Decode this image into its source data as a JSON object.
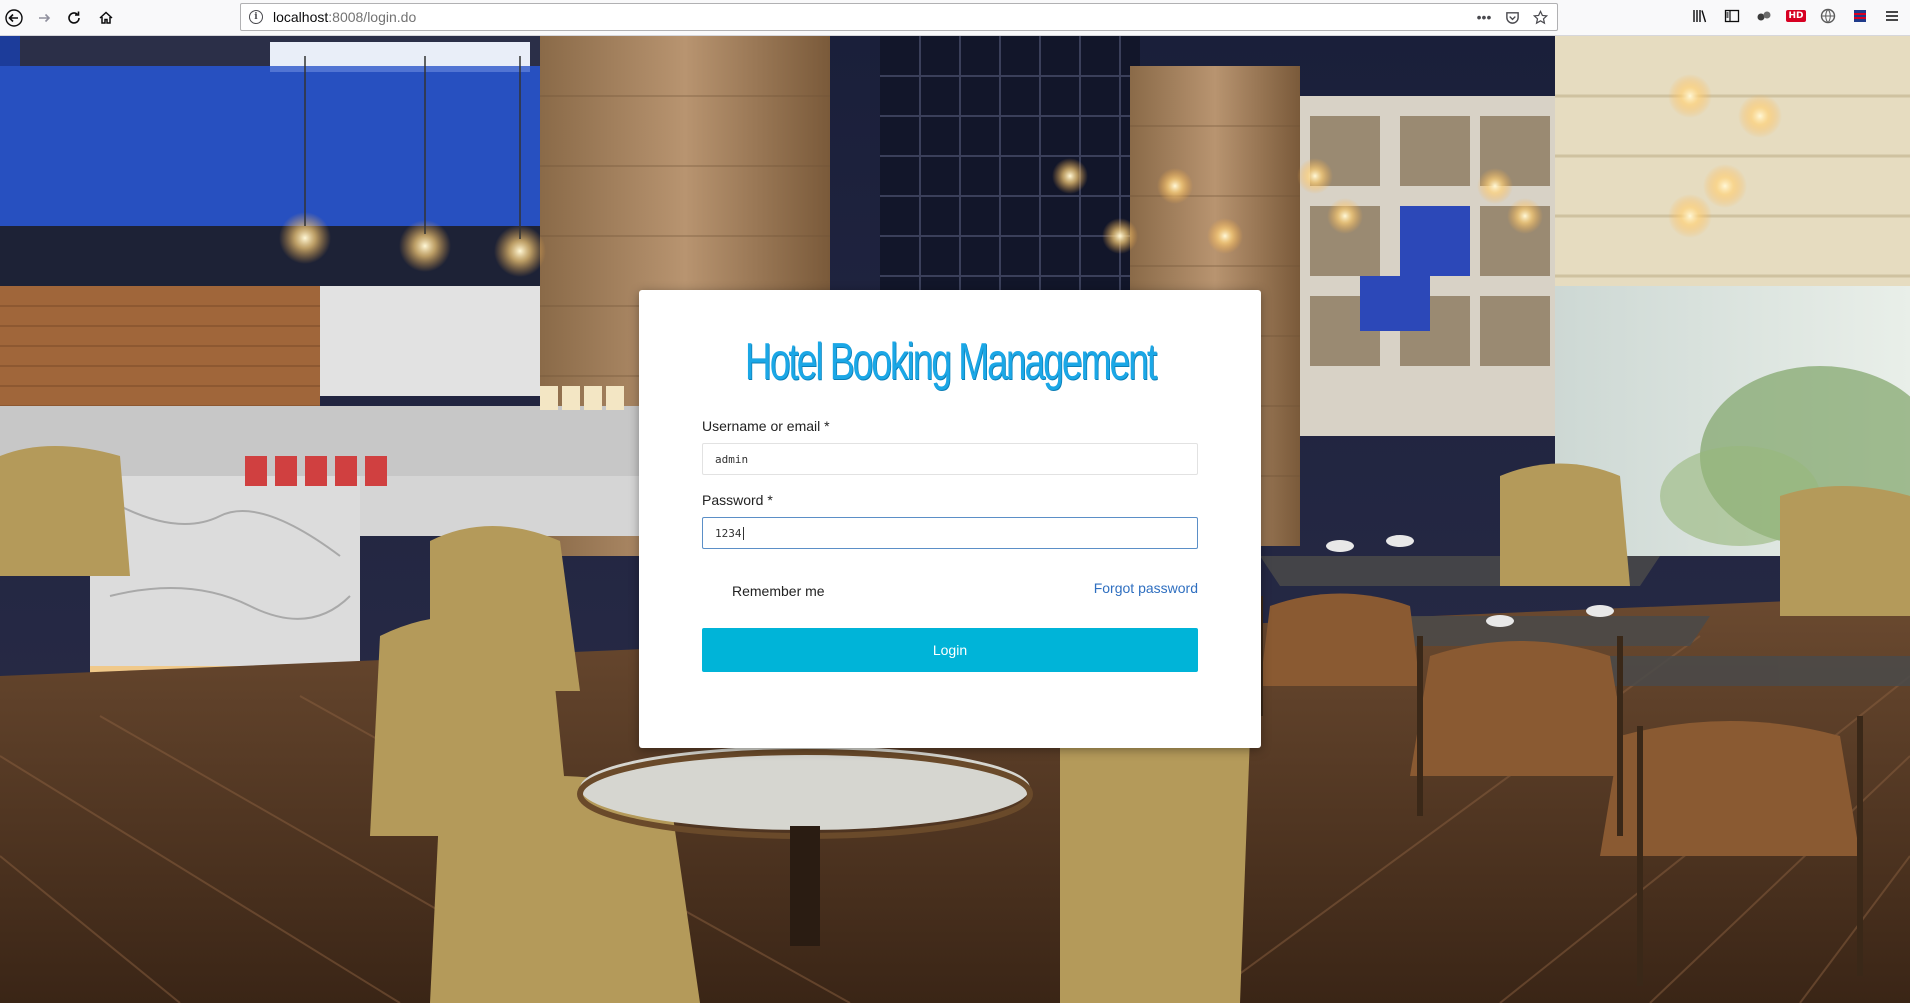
{
  "browser": {
    "url_host": "localhost",
    "url_path": ":8008/login.do"
  },
  "login": {
    "title": "Hotel Booking Management",
    "username_label": "Username or email *",
    "username_value": "admin",
    "password_label": "Password *",
    "password_value": "1234",
    "remember_label": "Remember me",
    "forgot_label": "Forgot password",
    "submit_label": "Login"
  },
  "colors": {
    "accent": "#00b4d8",
    "title": "#1ba7e6",
    "link": "#2f6fc0"
  }
}
